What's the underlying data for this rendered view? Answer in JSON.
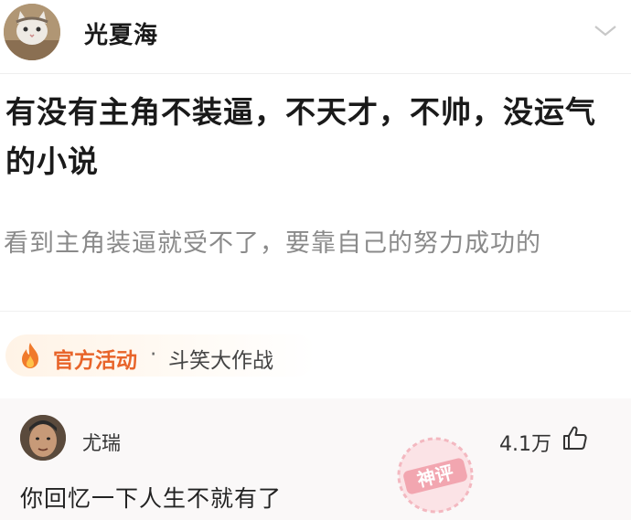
{
  "header": {
    "author": "光夏海"
  },
  "post": {
    "title": "有没有主角不装逼，不天才，不帅，没运气的小说",
    "description": "看到主角装逼就受不了，要靠自己的努力成功的"
  },
  "activity": {
    "label": "官方活动",
    "separator": "·",
    "name": "斗笑大作战"
  },
  "comment": {
    "user": "尤瑞",
    "likes": "4.1万",
    "text": "你回忆一下人生不就有了",
    "badge": "神评"
  },
  "colors": {
    "accent": "#e8642a",
    "badge": "#e85a6a"
  },
  "icons": [
    "chevron-down-icon",
    "flame-icon",
    "thumbs-up-icon"
  ]
}
